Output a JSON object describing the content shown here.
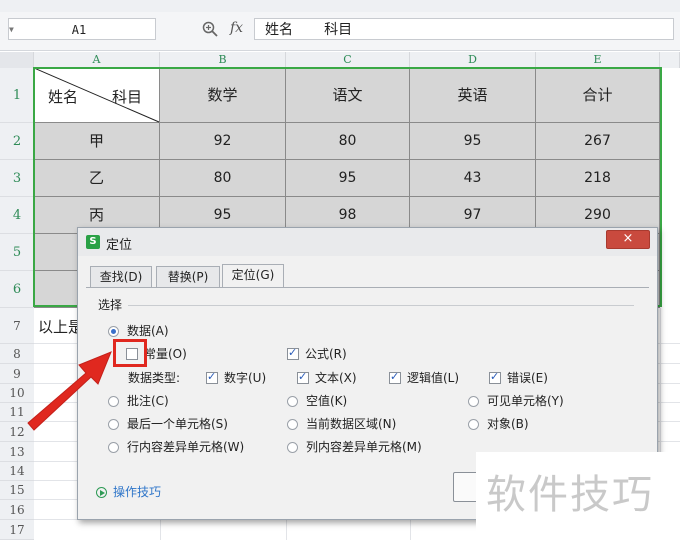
{
  "formula_bar": {
    "name_box": "A1",
    "fx_label": "fx",
    "content": "姓名       科目"
  },
  "columns": [
    "A",
    "B",
    "C",
    "D",
    "E"
  ],
  "rows": [
    "1",
    "2",
    "3",
    "4",
    "5",
    "6",
    "7",
    "8",
    "9",
    "10",
    "11",
    "12",
    "13",
    "14",
    "15",
    "16",
    "17"
  ],
  "table": {
    "header": {
      "diag_left": "姓名",
      "diag_right": "科目",
      "cols": [
        "数学",
        "语文",
        "英语",
        "合计"
      ]
    },
    "records": [
      {
        "name": "甲",
        "values": [
          "92",
          "80",
          "95",
          "267"
        ]
      },
      {
        "name": "乙",
        "values": [
          "80",
          "95",
          "43",
          "218"
        ]
      },
      {
        "name": "丙",
        "values": [
          "95",
          "98",
          "97",
          "290"
        ]
      }
    ]
  },
  "row7_text": "以上是",
  "dialog": {
    "title": "定位",
    "app_icon": "S",
    "close": "×",
    "tabs": [
      "查找(D)",
      "替换(P)",
      "定位(G)"
    ],
    "active_tab": "定位(G)",
    "section_title": "选择",
    "data_radio": "数据(A)",
    "constant": "常量(O)",
    "formula": "公式(R)",
    "data_types_label": "数据类型:",
    "data_types": [
      "数字(U)",
      "文本(X)",
      "逻辑值(L)",
      "错误(E)"
    ],
    "radios": [
      [
        "批注(C)",
        "空值(K)",
        "可见单元格(Y)"
      ],
      [
        "最后一个单元格(S)",
        "当前数据区域(N)",
        "对象(B)"
      ],
      [
        "行内容差异单元格(W)",
        "列内容差异单元格(M)"
      ]
    ],
    "tips": "操作技巧"
  },
  "watermark": "软件技巧",
  "colors": {
    "accent_green": "#3aa845",
    "highlight_red": "#e0281f",
    "header_gray": "#d6d6d6"
  }
}
